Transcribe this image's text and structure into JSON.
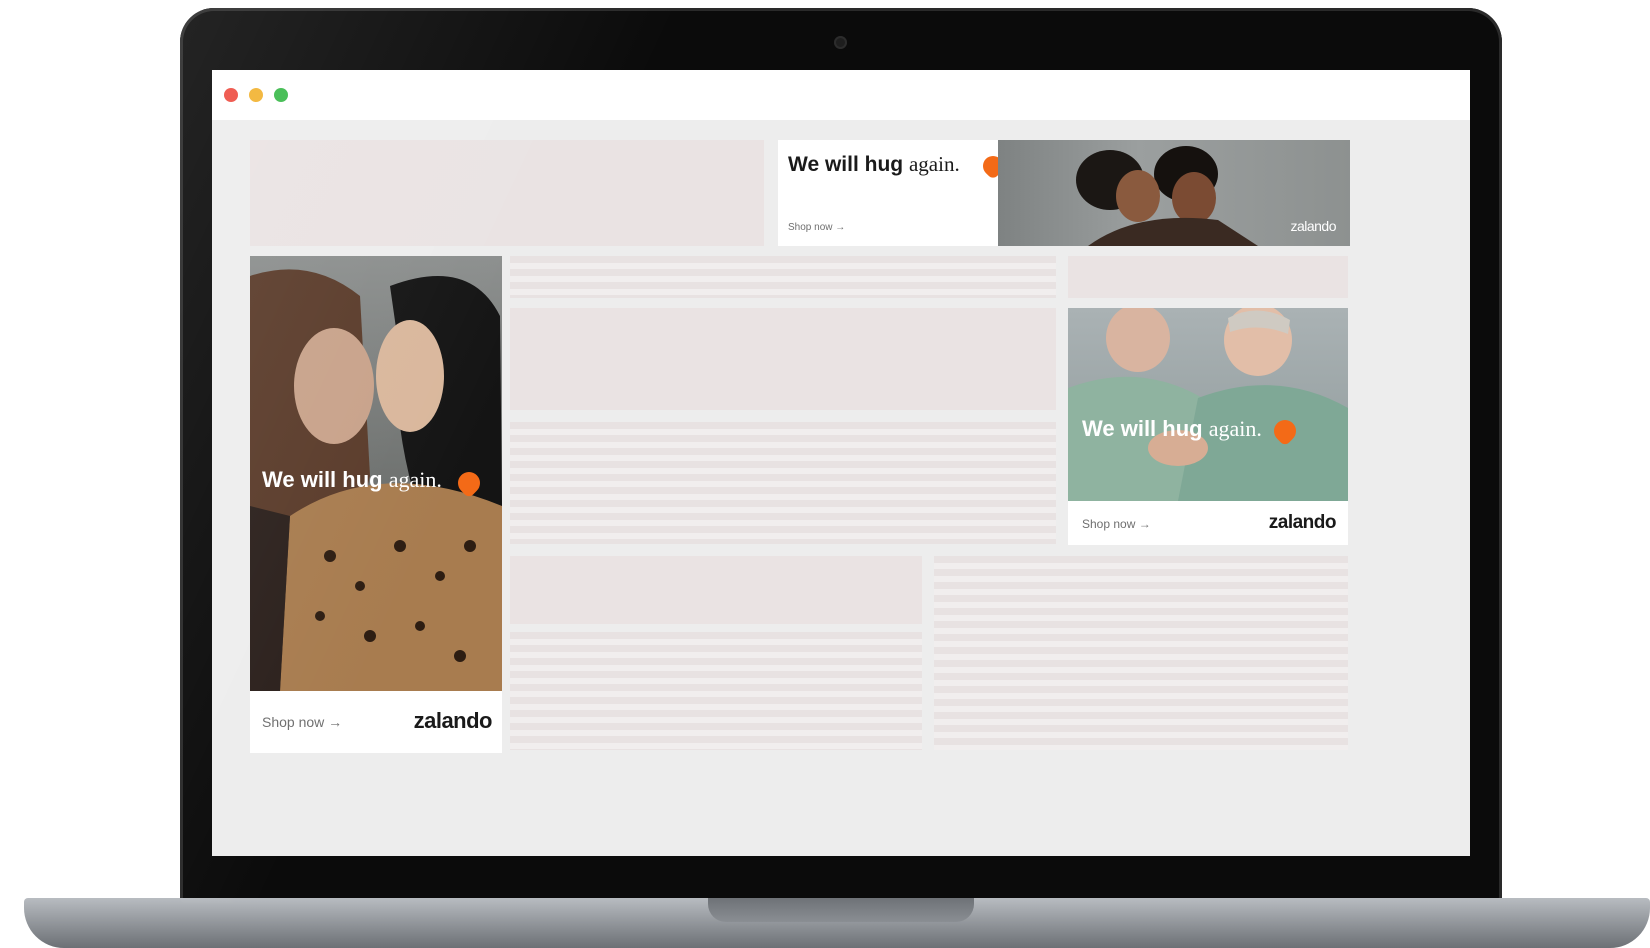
{
  "browser": {
    "window_controls": [
      "close",
      "minimize",
      "zoom"
    ],
    "colors": {
      "close": "#ee4e43",
      "minimize": "#f2b332",
      "zoom": "#3cba4c"
    }
  },
  "brand": {
    "accent_color": "#f36a17",
    "heart_icon": "heart-icon"
  },
  "ads": {
    "leaderboard": {
      "headline_bold": "We will hug",
      "headline_serif": "again.",
      "cta": "Shop now →",
      "logo": "zalando"
    },
    "skyscraper": {
      "headline_bold": "We will hug",
      "headline_serif": "again.",
      "cta": "Shop now →",
      "logo": "zalando"
    },
    "rectangle": {
      "headline_bold": "We will hug",
      "headline_serif": "again.",
      "cta": "Shop now →",
      "logo": "zalando"
    }
  }
}
